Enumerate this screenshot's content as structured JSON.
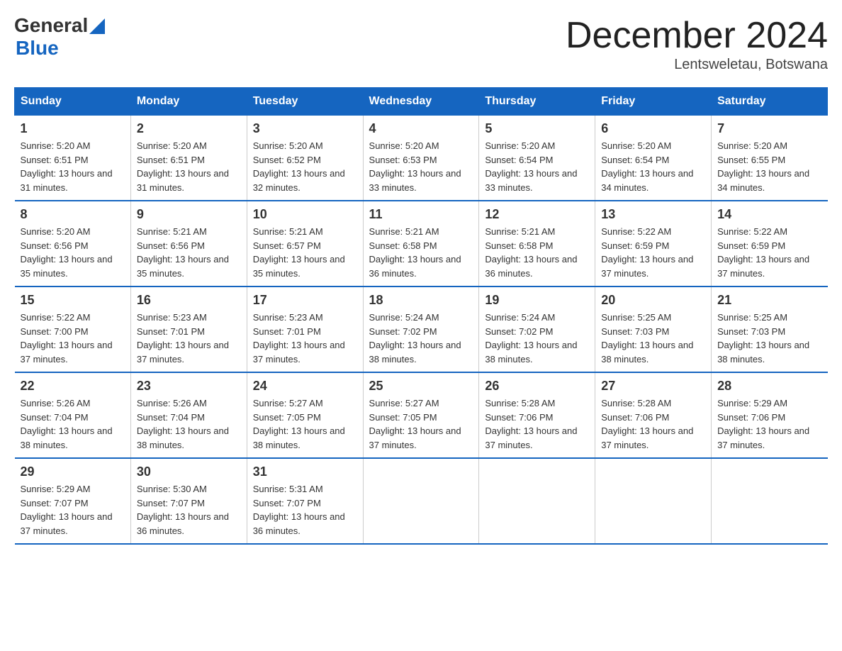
{
  "header": {
    "logo_general": "General",
    "logo_blue": "Blue",
    "month_title": "December 2024",
    "location": "Lentsweletau, Botswana"
  },
  "weekdays": [
    "Sunday",
    "Monday",
    "Tuesday",
    "Wednesday",
    "Thursday",
    "Friday",
    "Saturday"
  ],
  "weeks": [
    [
      {
        "day": "1",
        "sunrise": "5:20 AM",
        "sunset": "6:51 PM",
        "daylight": "13 hours and 31 minutes."
      },
      {
        "day": "2",
        "sunrise": "5:20 AM",
        "sunset": "6:51 PM",
        "daylight": "13 hours and 31 minutes."
      },
      {
        "day": "3",
        "sunrise": "5:20 AM",
        "sunset": "6:52 PM",
        "daylight": "13 hours and 32 minutes."
      },
      {
        "day": "4",
        "sunrise": "5:20 AM",
        "sunset": "6:53 PM",
        "daylight": "13 hours and 33 minutes."
      },
      {
        "day": "5",
        "sunrise": "5:20 AM",
        "sunset": "6:54 PM",
        "daylight": "13 hours and 33 minutes."
      },
      {
        "day": "6",
        "sunrise": "5:20 AM",
        "sunset": "6:54 PM",
        "daylight": "13 hours and 34 minutes."
      },
      {
        "day": "7",
        "sunrise": "5:20 AM",
        "sunset": "6:55 PM",
        "daylight": "13 hours and 34 minutes."
      }
    ],
    [
      {
        "day": "8",
        "sunrise": "5:20 AM",
        "sunset": "6:56 PM",
        "daylight": "13 hours and 35 minutes."
      },
      {
        "day": "9",
        "sunrise": "5:21 AM",
        "sunset": "6:56 PM",
        "daylight": "13 hours and 35 minutes."
      },
      {
        "day": "10",
        "sunrise": "5:21 AM",
        "sunset": "6:57 PM",
        "daylight": "13 hours and 35 minutes."
      },
      {
        "day": "11",
        "sunrise": "5:21 AM",
        "sunset": "6:58 PM",
        "daylight": "13 hours and 36 minutes."
      },
      {
        "day": "12",
        "sunrise": "5:21 AM",
        "sunset": "6:58 PM",
        "daylight": "13 hours and 36 minutes."
      },
      {
        "day": "13",
        "sunrise": "5:22 AM",
        "sunset": "6:59 PM",
        "daylight": "13 hours and 37 minutes."
      },
      {
        "day": "14",
        "sunrise": "5:22 AM",
        "sunset": "6:59 PM",
        "daylight": "13 hours and 37 minutes."
      }
    ],
    [
      {
        "day": "15",
        "sunrise": "5:22 AM",
        "sunset": "7:00 PM",
        "daylight": "13 hours and 37 minutes."
      },
      {
        "day": "16",
        "sunrise": "5:23 AM",
        "sunset": "7:01 PM",
        "daylight": "13 hours and 37 minutes."
      },
      {
        "day": "17",
        "sunrise": "5:23 AM",
        "sunset": "7:01 PM",
        "daylight": "13 hours and 37 minutes."
      },
      {
        "day": "18",
        "sunrise": "5:24 AM",
        "sunset": "7:02 PM",
        "daylight": "13 hours and 38 minutes."
      },
      {
        "day": "19",
        "sunrise": "5:24 AM",
        "sunset": "7:02 PM",
        "daylight": "13 hours and 38 minutes."
      },
      {
        "day": "20",
        "sunrise": "5:25 AM",
        "sunset": "7:03 PM",
        "daylight": "13 hours and 38 minutes."
      },
      {
        "day": "21",
        "sunrise": "5:25 AM",
        "sunset": "7:03 PM",
        "daylight": "13 hours and 38 minutes."
      }
    ],
    [
      {
        "day": "22",
        "sunrise": "5:26 AM",
        "sunset": "7:04 PM",
        "daylight": "13 hours and 38 minutes."
      },
      {
        "day": "23",
        "sunrise": "5:26 AM",
        "sunset": "7:04 PM",
        "daylight": "13 hours and 38 minutes."
      },
      {
        "day": "24",
        "sunrise": "5:27 AM",
        "sunset": "7:05 PM",
        "daylight": "13 hours and 38 minutes."
      },
      {
        "day": "25",
        "sunrise": "5:27 AM",
        "sunset": "7:05 PM",
        "daylight": "13 hours and 37 minutes."
      },
      {
        "day": "26",
        "sunrise": "5:28 AM",
        "sunset": "7:06 PM",
        "daylight": "13 hours and 37 minutes."
      },
      {
        "day": "27",
        "sunrise": "5:28 AM",
        "sunset": "7:06 PM",
        "daylight": "13 hours and 37 minutes."
      },
      {
        "day": "28",
        "sunrise": "5:29 AM",
        "sunset": "7:06 PM",
        "daylight": "13 hours and 37 minutes."
      }
    ],
    [
      {
        "day": "29",
        "sunrise": "5:29 AM",
        "sunset": "7:07 PM",
        "daylight": "13 hours and 37 minutes."
      },
      {
        "day": "30",
        "sunrise": "5:30 AM",
        "sunset": "7:07 PM",
        "daylight": "13 hours and 36 minutes."
      },
      {
        "day": "31",
        "sunrise": "5:31 AM",
        "sunset": "7:07 PM",
        "daylight": "13 hours and 36 minutes."
      },
      null,
      null,
      null,
      null
    ]
  ]
}
